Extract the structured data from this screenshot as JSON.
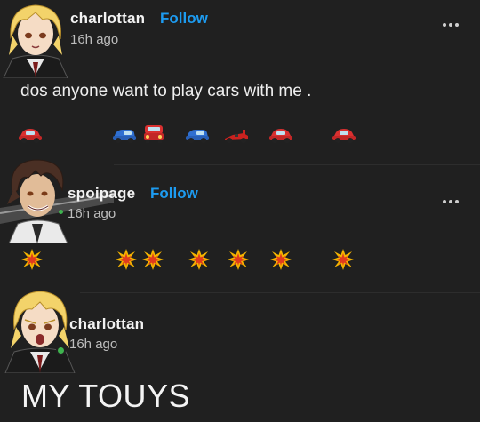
{
  "posts": [
    {
      "username": "charlottan",
      "follow_label": "Follow",
      "timestamp": "16h ago",
      "text": "dos anyone want to play cars with me .",
      "emoji_row": [
        "red-car",
        "blue-car",
        "red-car",
        "blue-car",
        "race-car",
        "red-car",
        "red-car"
      ]
    },
    {
      "username": "spoipage",
      "follow_label": "Follow",
      "timestamp": "16h ago",
      "emoji_row": [
        "collision",
        "collision",
        "collision",
        "collision",
        "collision",
        "collision",
        "collision"
      ]
    },
    {
      "username": "charlottan",
      "timestamp": "16h ago",
      "text": "MY TOUYS"
    }
  ],
  "colors": {
    "background": "#202020",
    "follow_link": "#1d9bf0",
    "online_dot": "#3fb34f"
  }
}
